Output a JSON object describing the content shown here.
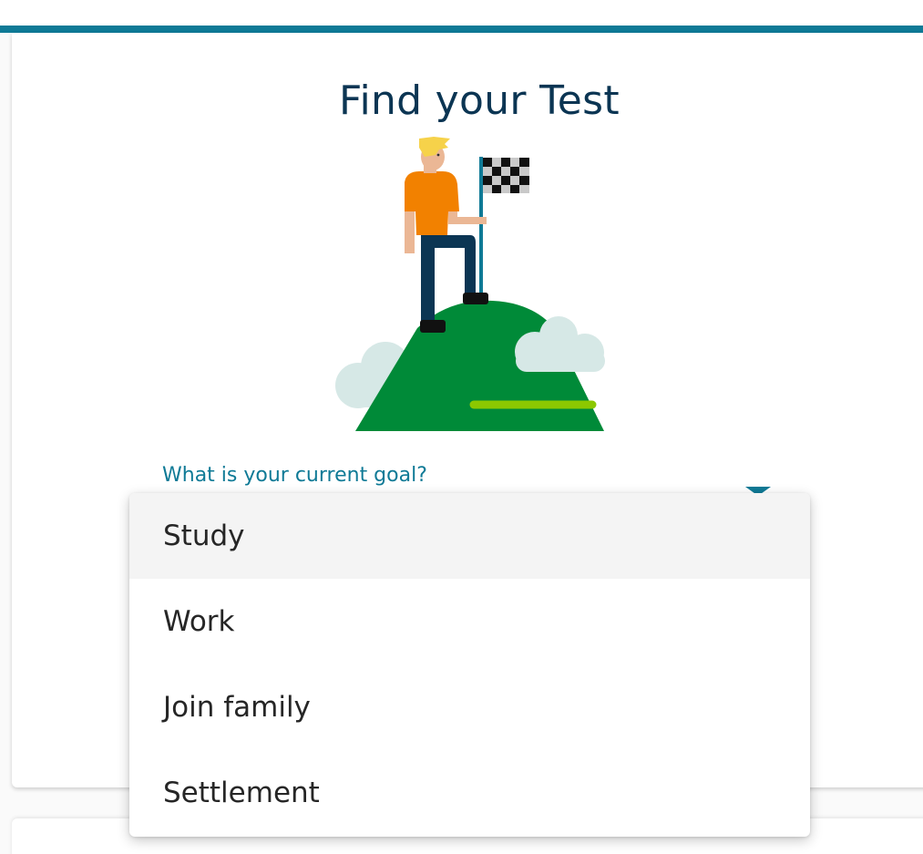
{
  "colors": {
    "accent": "#0f7a96",
    "title": "#0b3553",
    "label": "#0f7a96",
    "hill": "#008a38",
    "hill_stripe": "#8cc800",
    "cloud": "#d6e8e6",
    "shirt": "#f28100",
    "pants": "#0b3553",
    "hair": "#f6d24a",
    "skin": "#ebb795"
  },
  "card": {
    "title": "Find your Test"
  },
  "form": {
    "goal_label": "What is your current goal?"
  },
  "dropdown": {
    "options": [
      "Study",
      "Work",
      "Join family",
      "Settlement"
    ],
    "hovered_option": "Study"
  },
  "icons": {
    "dropdown_arrow": "chevron-down-icon",
    "illustration": "person-with-flag-on-hill-illustration"
  }
}
